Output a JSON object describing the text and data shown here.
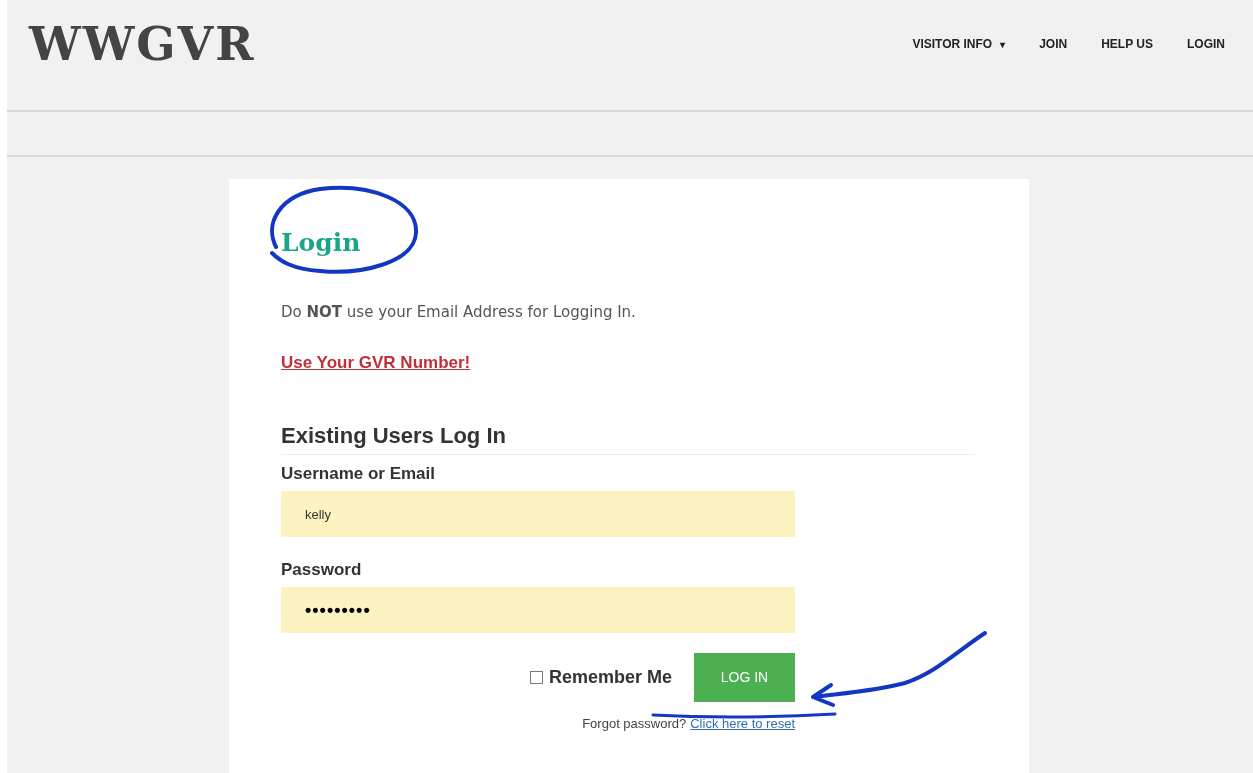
{
  "header": {
    "logo": "WWGVR",
    "nav": [
      {
        "label": "VISITOR INFO",
        "caret": "▾"
      },
      {
        "label": "JOIN"
      },
      {
        "label": "HELP US"
      },
      {
        "label": "LOGIN"
      }
    ]
  },
  "login": {
    "title": "Login",
    "notice": "Do **NOT** use your Email Address for Logging In.",
    "gvr_link": "Use Your GVR Number!",
    "section_title": "Existing Users Log In",
    "fields": [
      {
        "label": "Username or Email",
        "value": "kelly",
        "kind": "text"
      },
      {
        "label": "Password",
        "value": "•••••••••",
        "kind": "password"
      }
    ],
    "remember": {
      "label": "Remember Me",
      "checked": false
    },
    "submit": "LOG IN",
    "forgot": {
      "text": "Forgot password?",
      "link": "Click here to reset"
    }
  }
}
